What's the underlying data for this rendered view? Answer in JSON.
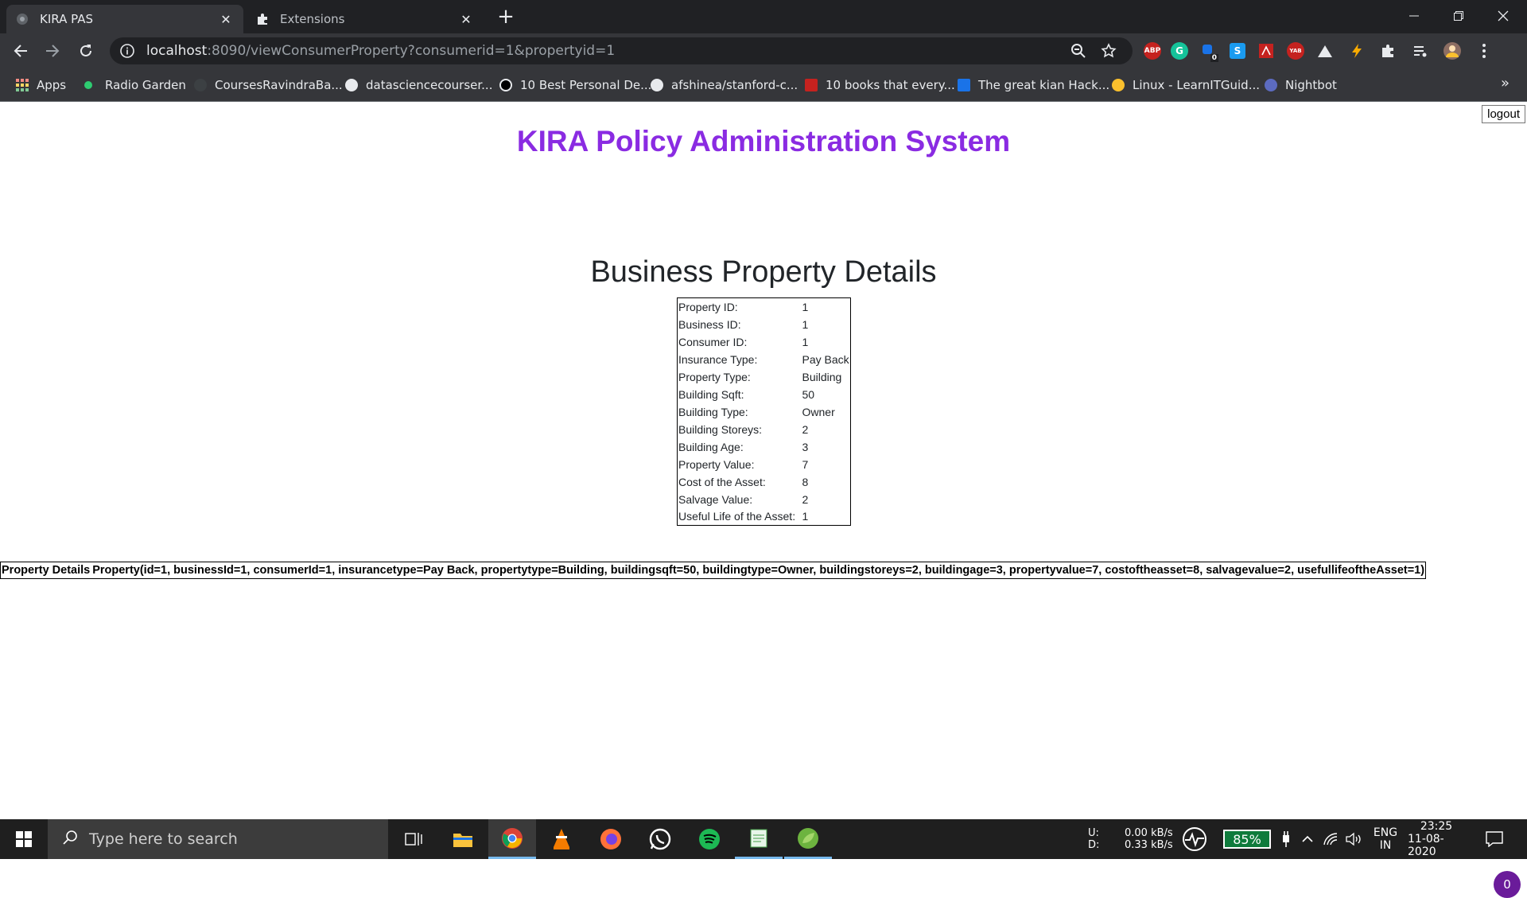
{
  "browser": {
    "tabs": [
      {
        "title": "KIRA PAS",
        "favicon": "globe-icon"
      },
      {
        "title": "Extensions",
        "favicon": "puzzle-icon"
      }
    ],
    "url_host": "localhost",
    "url_rest": ":8090/viewConsumerProperty?consumerid=1&propertyid=1",
    "extensions": [
      "ABP",
      "G",
      "0",
      "S",
      "YAB"
    ],
    "bookmarks": [
      "Apps",
      "Radio Garden",
      "CoursesRavindraBa...",
      "datasciencecourser...",
      "10 Best Personal De...",
      "afshinea/stanford-c...",
      "10 books that every...",
      "The great kian Hack...",
      "Linux - LearnITGuid...",
      "Nightbot"
    ]
  },
  "page": {
    "logout_label": "logout",
    "app_title": "KIRA Policy Administration System",
    "section_title": "Business Property Details",
    "details": [
      {
        "label": "Property ID:",
        "value": "1"
      },
      {
        "label": "Business ID:",
        "value": "1"
      },
      {
        "label": "Consumer ID:",
        "value": "1"
      },
      {
        "label": "Insurance Type:",
        "value": "Pay Back"
      },
      {
        "label": "Property Type:",
        "value": "Building"
      },
      {
        "label": "Building Sqft:",
        "value": "50"
      },
      {
        "label": "Building Type:",
        "value": "Owner"
      },
      {
        "label": "Building Storeys:",
        "value": "2"
      },
      {
        "label": "Building Age:",
        "value": "3"
      },
      {
        "label": "Property Value:",
        "value": "7"
      },
      {
        "label": "Cost of the Asset:",
        "value": "8"
      },
      {
        "label": "Salvage Value:",
        "value": "2"
      },
      {
        "label": "Useful Life of the Asset:",
        "value": "1"
      }
    ],
    "summary_label": "Property Details",
    "summary_value": "Property(id=1, businessId=1, consumerId=1, insurancetype=Pay Back, propertytype=Building, buildingsqft=50, buildingtype=Owner, buildingstoreys=2, buildingage=3, propertyvalue=7, costoftheasset=8, salvagevalue=2, usefullifeoftheAsset=1)",
    "badge_count": "0"
  },
  "taskbar": {
    "search_placeholder": "Type here to search",
    "net_up_label": "U:",
    "net_down_label": "D:",
    "net_up": "0.00 kB/s",
    "net_down": "0.33 kB/s",
    "battery": "85%",
    "lang": "ENG",
    "region": "IN",
    "time": "23:25",
    "date": "11-08-2020"
  },
  "colors": {
    "title_purple": "#8a2be2",
    "chrome_dark": "#202124",
    "chrome_bar": "#35363a"
  }
}
